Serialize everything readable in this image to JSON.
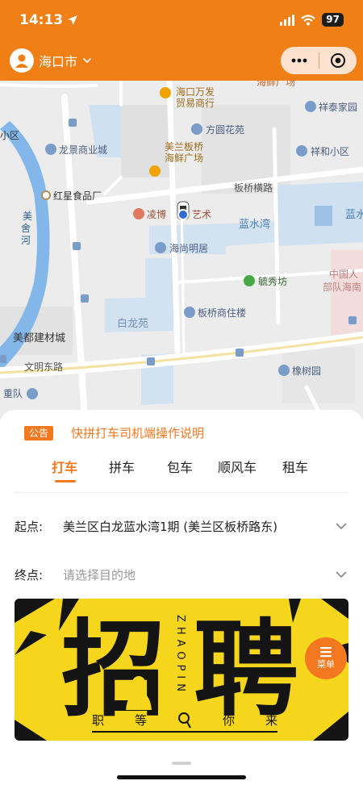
{
  "status_bar": {
    "time": "14:13",
    "battery": "97"
  },
  "header": {
    "city": "海口市",
    "colors": {
      "brand": "#f08016"
    }
  },
  "map": {
    "labels": {
      "mall_top": "海鲜广场",
      "home_top": "祥泰家园",
      "wanda_1": "海口万发",
      "wanda_2": "贸易商行",
      "district": "小区",
      "fangyuan": "方圆花苑",
      "longjing": "龙景商业城",
      "xianghe": "祥和小区",
      "meilan_1": "美兰板桥",
      "meilan_2": "海鲜广场",
      "hongxing": "红星食品厂",
      "road_banqiao": "板桥横路",
      "river_1": "美",
      "river_2": "舍",
      "river_3": "河",
      "lingbo": "凌博",
      "art": "艺术",
      "lanshuiwan": "蓝水湾",
      "lanshui_right": "蓝水",
      "haishang": "海尚明居",
      "zhongguo_1": "中国人",
      "zhongguo_2": "部队海南",
      "yuxiu": "毓秀坊",
      "bailong": "白龙苑",
      "banqiao_building": "板桥商住楼",
      "meidu": "美都建材城",
      "wenming": "文明东路",
      "xiangshu": "橡树园",
      "zhongdui": "重队"
    }
  },
  "notice": {
    "badge": "公告",
    "text": "快拼打车司机端操作说明"
  },
  "tabs": [
    {
      "label": "打车",
      "active": true
    },
    {
      "label": "拼车",
      "active": false
    },
    {
      "label": "包车",
      "active": false
    },
    {
      "label": "顺风车",
      "active": false
    },
    {
      "label": "租车",
      "active": false
    }
  ],
  "form": {
    "start_label": "起点:",
    "start_value": "美兰区白龙蓝水湾1期 (美兰区板桥路东)",
    "end_label": "终点:",
    "end_placeholder": "请选择目的地"
  },
  "banner": {
    "big_left": "招",
    "big_right": "聘",
    "vertical": "ZHAOPIN",
    "slogan": [
      "职",
      "等",
      "你",
      "来"
    ],
    "menu_label": "菜单"
  }
}
